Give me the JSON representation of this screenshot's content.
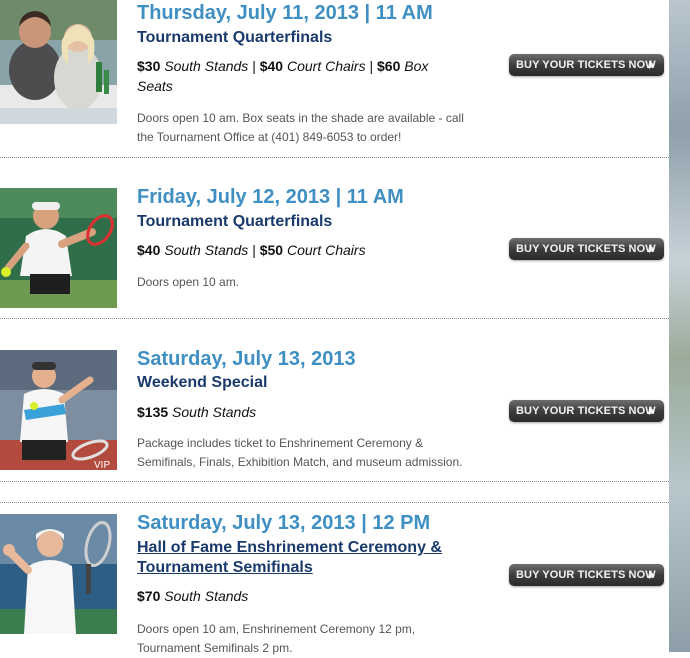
{
  "events": [
    {
      "date": "Thursday, July 11, 2013 | 11 AM",
      "title_lines": [
        "Tournament Quarterfinals"
      ],
      "price_1_amount": "$30",
      "price_1_place": "South Stands",
      "price_2_amount": "$40",
      "price_2_place": "Court Chairs",
      "price_3_amount": "$60",
      "price_3_place": "Box Seats",
      "separator": "|",
      "description": "Doors open 10 am. Box seats in the shade are available - call the Tournament Office at (401) 849-6053 to order!",
      "button_label": "BUY YOUR TICKETS NOW"
    },
    {
      "date": "Friday, July 12, 2013 | 11 AM",
      "title_lines": [
        "Tournament Quarterfinals"
      ],
      "price_1_amount": "$40",
      "price_1_place": "South Stands",
      "price_2_amount": "$50",
      "price_2_place": "Court Chairs",
      "separator": "|",
      "description": "Doors open 10 am.",
      "button_label": "BUY YOUR TICKETS NOW"
    },
    {
      "date": "Saturday, July 13, 2013",
      "title_lines": [
        "Weekend Special"
      ],
      "price_1_amount": "$135",
      "price_1_place": "South Stands",
      "description": "Package includes ticket to Enshrinement Ceremony & Semifinals, Finals, Exhibition Match, and museum admission.",
      "button_label": "BUY YOUR TICKETS NOW"
    },
    {
      "date": "Saturday, July 13, 2013 | 12 PM",
      "title_lines": [
        "Hall of Fame Enshrinement Ceremony &",
        "Tournament Semifinals"
      ],
      "price_1_amount": "$70",
      "price_1_place": "South Stands",
      "description": "Doors open 10 am, Enshrinement Ceremony 12 pm, Tournament Semifinals 2 pm.",
      "button_label": "BUY YOUR TICKETS NOW"
    }
  ],
  "photo_banner_text": "VIP",
  "colors": {
    "date": "#3f8fc3",
    "title": "#1a3a6b",
    "button": "#3d3d3d"
  }
}
